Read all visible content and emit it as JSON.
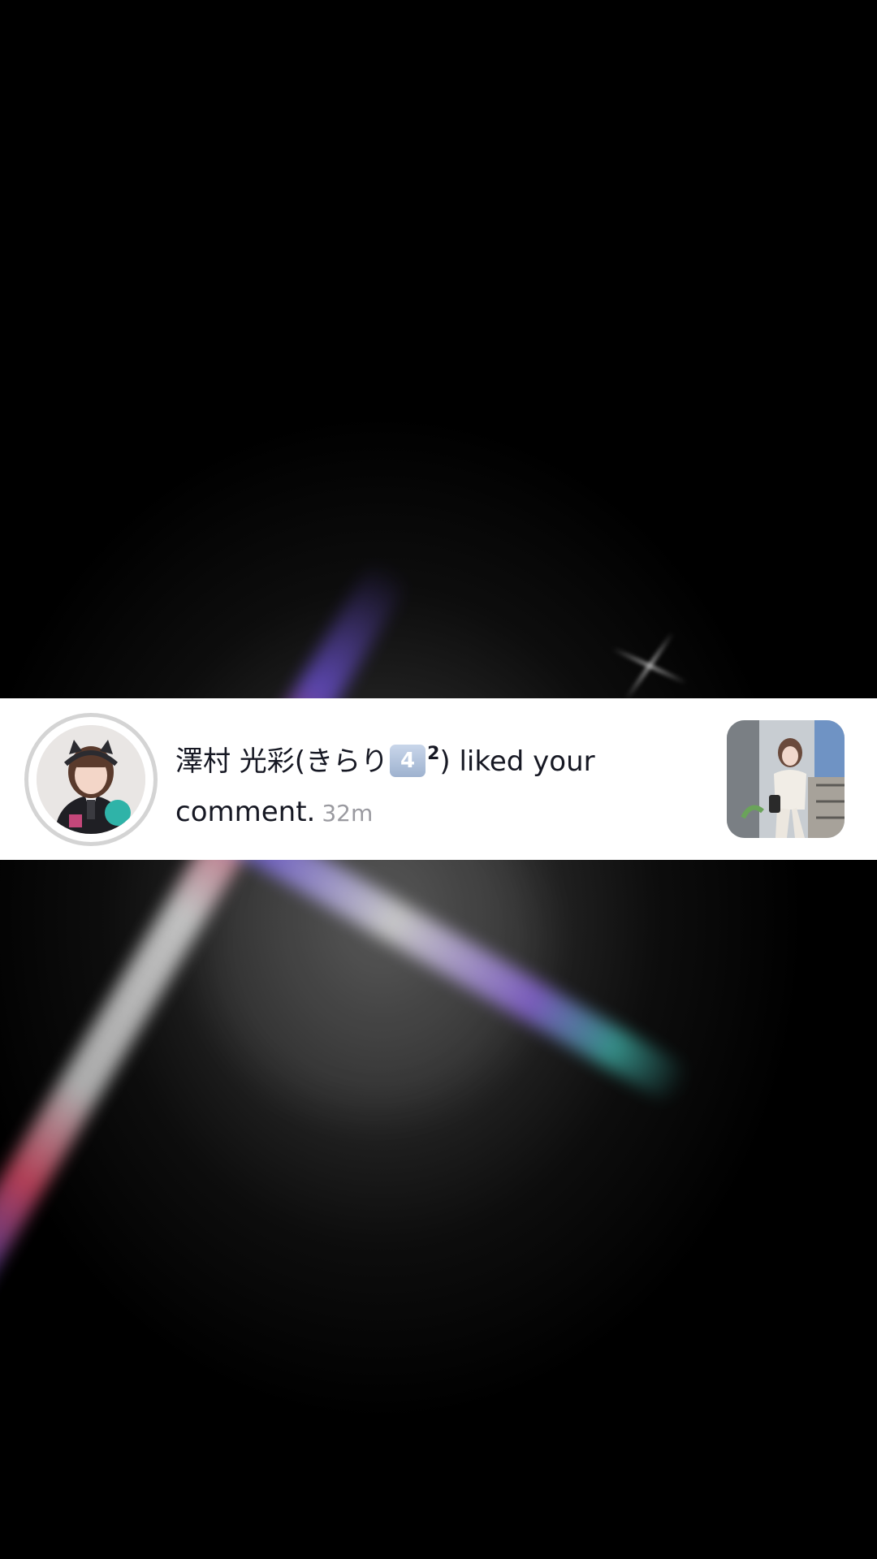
{
  "notification": {
    "username": "澤村 光彩(きらり",
    "keycap": "4",
    "superscript": "2",
    "close_paren": ")",
    "action_line1": " liked your",
    "action_line2": "comment.",
    "time": "32m",
    "avatar_icon": "user-avatar-photo",
    "thumbnail_icon": "video-thumbnail-photo"
  },
  "colors": {
    "banner_bg": "#ffffff",
    "text": "#161823",
    "timestamp": "#9a9aa0",
    "avatar_ring": "#d4d4d4"
  }
}
